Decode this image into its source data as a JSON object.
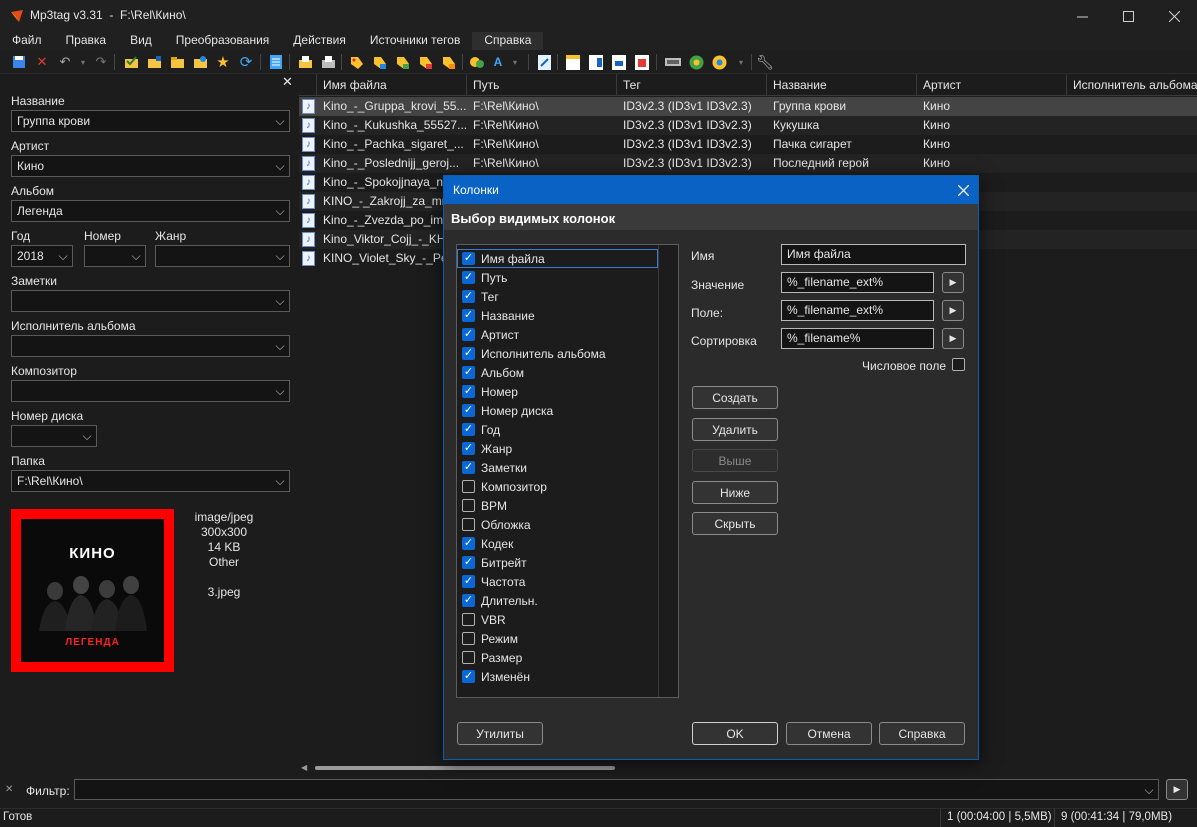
{
  "window": {
    "title": "Mp3tag v3.31  -  F:\\Rel\\Кино\\"
  },
  "menu": [
    "Файл",
    "Правка",
    "Вид",
    "Преобразования",
    "Действия",
    "Источники тегов",
    "Справка"
  ],
  "left_panel": {
    "fields": {
      "title": {
        "label": "Название",
        "value": "Группа крови"
      },
      "artist": {
        "label": "Артист",
        "value": "Кино"
      },
      "album": {
        "label": "Альбом",
        "value": "Легенда"
      },
      "year": {
        "label": "Год",
        "value": "2018"
      },
      "track": {
        "label": "Номер",
        "value": ""
      },
      "genre": {
        "label": "Жанр",
        "value": ""
      },
      "comment": {
        "label": "Заметки",
        "value": ""
      },
      "album_artist": {
        "label": "Исполнитель альбома",
        "value": ""
      },
      "composer": {
        "label": "Композитор",
        "value": ""
      },
      "disc": {
        "label": "Номер диска",
        "value": ""
      },
      "folder": {
        "label": "Папка",
        "value": "F:\\Rel\\Кино\\"
      }
    },
    "cover": {
      "band": "КИНО",
      "album": "ЛЕГЕНДА",
      "info": [
        "image/jpeg",
        "300x300",
        "14 KB",
        "Other",
        "",
        "3.jpeg"
      ]
    },
    "colors": {
      "cover_border": "#ff0000",
      "cover_bg": "#0a0a0a"
    }
  },
  "file_list": {
    "headers": [
      "Имя файла",
      "Путь",
      "Тег",
      "Название",
      "Артист",
      "Исполнитель альбома"
    ],
    "rows": [
      {
        "name": "Kino_-_Gruppa_krovi_55...",
        "path": "F:\\Rel\\Кино\\",
        "tag": "ID3v2.3 (ID3v1 ID3v2.3)",
        "title": "Группа крови",
        "artist": "Кино",
        "selected": true
      },
      {
        "name": "Kino_-_Kukushka_55527...",
        "path": "F:\\Rel\\Кино\\",
        "tag": "ID3v2.3 (ID3v1 ID3v2.3)",
        "title": "Кукушка",
        "artist": "Кино",
        "selected": false
      },
      {
        "name": "Kino_-_Pachka_sigaret_...",
        "path": "F:\\Rel\\Кино\\",
        "tag": "ID3v2.3 (ID3v1 ID3v2.3)",
        "title": "Пачка сигарет",
        "artist": "Кино",
        "selected": false
      },
      {
        "name": "Kino_-_Poslednijj_geroj...",
        "path": "F:\\Rel\\Кино\\",
        "tag": "ID3v2.3 (ID3v1 ID3v2.3)",
        "title": "Последний герой",
        "artist": "Кино",
        "selected": false
      },
      {
        "name": "Kino_-_Spokojjnaya_no",
        "path": "",
        "tag": "",
        "title": "",
        "artist": "",
        "selected": false
      },
      {
        "name": "KINO_-_Zakrojj_za_mno",
        "path": "",
        "tag": "",
        "title": "",
        "artist": "",
        "selected": false
      },
      {
        "name": "Kino_-_Zvezda_po_ime",
        "path": "",
        "tag": "",
        "title": "",
        "artist": "",
        "selected": false
      },
      {
        "name": "Kino_Viktor_Cojj_-_KHo",
        "path": "",
        "tag": "",
        "title": "",
        "artist": "тор Цой",
        "selected": false
      },
      {
        "name": "KINO_Violet_Sky_-_Pesi",
        "path": "",
        "tag": "",
        "title": "",
        "artist": "let Sky",
        "selected": false
      }
    ]
  },
  "filter": {
    "label": "Фильтр:",
    "value": ""
  },
  "status": {
    "ready": "Готов",
    "selection": "1 (00:04:00 | 5,5MB)",
    "total": "9 (00:41:34 | 79,0MB)"
  },
  "dialog": {
    "title": "Колонки",
    "subtitle": "Выбор видимых колонок",
    "columns": [
      {
        "label": "Имя файла",
        "checked": true
      },
      {
        "label": "Путь",
        "checked": true
      },
      {
        "label": "Тег",
        "checked": true
      },
      {
        "label": "Название",
        "checked": true
      },
      {
        "label": "Артист",
        "checked": true
      },
      {
        "label": "Исполнитель альбома",
        "checked": true
      },
      {
        "label": "Альбом",
        "checked": true
      },
      {
        "label": "Номер",
        "checked": true
      },
      {
        "label": "Номер диска",
        "checked": true
      },
      {
        "label": "Год",
        "checked": true
      },
      {
        "label": "Жанр",
        "checked": true
      },
      {
        "label": "Заметки",
        "checked": true
      },
      {
        "label": "Композитор",
        "checked": false
      },
      {
        "label": "BPM",
        "checked": false
      },
      {
        "label": "Обложка",
        "checked": false
      },
      {
        "label": "Кодек",
        "checked": true
      },
      {
        "label": "Битрейт",
        "checked": true
      },
      {
        "label": "Частота",
        "checked": true
      },
      {
        "label": "Длительн.",
        "checked": true
      },
      {
        "label": "VBR",
        "checked": false
      },
      {
        "label": "Режим",
        "checked": false
      },
      {
        "label": "Размер",
        "checked": false
      },
      {
        "label": "Изменён",
        "checked": true
      }
    ],
    "fields": {
      "name": {
        "label": "Имя",
        "value": "Имя файла"
      },
      "value": {
        "label": "Значение",
        "value": "%_filename_ext%"
      },
      "field": {
        "label": "Поле:",
        "value": "%_filename_ext%"
      },
      "sort": {
        "label": "Сортировка",
        "value": "%_filename%"
      }
    },
    "numeric_label": "Числовое поле",
    "numeric_checked": false,
    "buttons": {
      "create": "Создать",
      "delete": "Удалить",
      "up": "Выше",
      "down": "Ниже",
      "hide": "Скрыть",
      "utilities": "Утилиты",
      "ok": "OK",
      "cancel": "Отмена",
      "help": "Справка"
    },
    "colors": {
      "title_bar": "#0a63c4",
      "check_on": "#0a67d6"
    }
  }
}
